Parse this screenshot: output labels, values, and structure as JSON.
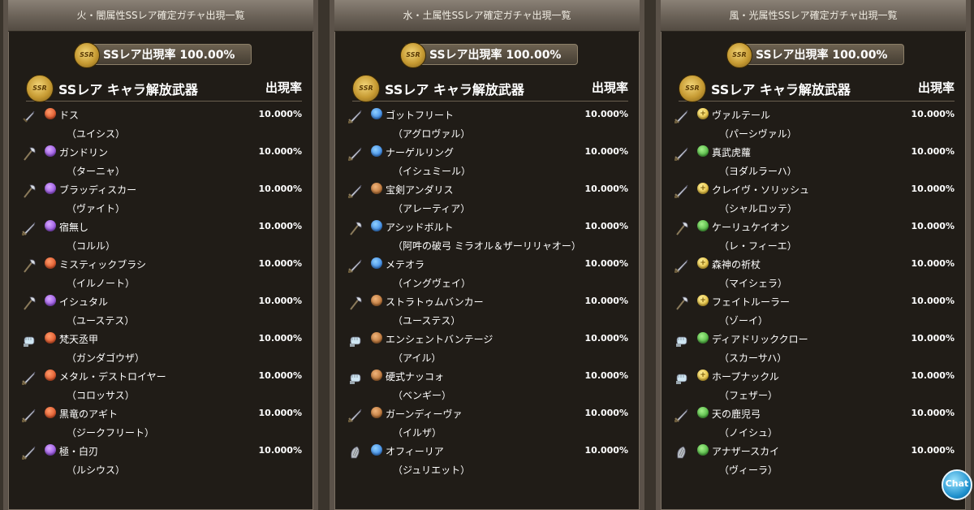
{
  "rate_banner": "SSレア出現率 100.00%",
  "ssr_badge": "SSR",
  "list_title": "SSレア キャラ解放武器",
  "rate_column": "出現率",
  "chat_label": "Chat",
  "panels": [
    {
      "title": "火・闇属性SSレア確定ガチャ出現一覧",
      "items": [
        {
          "weapon_icon": "dagger-icon",
          "element": "fire",
          "name": "ドス",
          "character": "（ユイシス）",
          "rate": "10.000%"
        },
        {
          "weapon_icon": "axe-icon",
          "element": "dark",
          "name": "ガンドリン",
          "character": "（ターニャ）",
          "rate": "10.000%"
        },
        {
          "weapon_icon": "axe-icon",
          "element": "dark",
          "name": "ブラッディスカー",
          "character": "（ヴァイト）",
          "rate": "10.000%"
        },
        {
          "weapon_icon": "sword-icon",
          "element": "dark",
          "name": "宿無し",
          "character": "（コルル）",
          "rate": "10.000%"
        },
        {
          "weapon_icon": "axe-icon",
          "element": "fire",
          "name": "ミスティックブラシ",
          "character": "（イルノート）",
          "rate": "10.000%"
        },
        {
          "weapon_icon": "axe-icon",
          "element": "dark",
          "name": "イシュタル",
          "character": "（ユーステス）",
          "rate": "10.000%"
        },
        {
          "weapon_icon": "fist-icon",
          "element": "fire",
          "name": "梵天丞甲",
          "character": "（ガンダゴウザ）",
          "rate": "10.000%"
        },
        {
          "weapon_icon": "sword-icon",
          "element": "fire",
          "name": "メタル・デストロイヤー",
          "character": "（コロッサス）",
          "rate": "10.000%"
        },
        {
          "weapon_icon": "sword-icon",
          "element": "fire",
          "name": "黒竜のアギト",
          "character": "（ジークフリート）",
          "rate": "10.000%"
        },
        {
          "weapon_icon": "sword-icon",
          "element": "dark",
          "name": "極・白刃",
          "character": "（ルシウス）",
          "rate": "10.000%"
        }
      ]
    },
    {
      "title": "水・土属性SSレア確定ガチャ出現一覧",
      "items": [
        {
          "weapon_icon": "sword-icon",
          "element": "water",
          "name": "ゴットフリート",
          "character": "（アグロヴァル）",
          "rate": "10.000%"
        },
        {
          "weapon_icon": "sword-icon",
          "element": "water",
          "name": "ナーゲルリング",
          "character": "（イシュミール）",
          "rate": "10.000%"
        },
        {
          "weapon_icon": "sword-icon",
          "element": "earth",
          "name": "宝剣アンダリス",
          "character": "（アレーティア）",
          "rate": "10.000%"
        },
        {
          "weapon_icon": "axe-icon",
          "element": "water",
          "name": "アシッドボルト",
          "character": "（阿吽の破弓 ミラオル＆ザーリリャオー）",
          "rate": "10.000%"
        },
        {
          "weapon_icon": "sword-icon",
          "element": "water",
          "name": "メテオラ",
          "character": "（イングヴェイ）",
          "rate": "10.000%"
        },
        {
          "weapon_icon": "axe-icon",
          "element": "earth",
          "name": "ストラトゥムバンカー",
          "character": "（ユーステス）",
          "rate": "10.000%"
        },
        {
          "weapon_icon": "fist-icon",
          "element": "earth",
          "name": "エンシェントバンテージ",
          "character": "（アイル）",
          "rate": "10.000%"
        },
        {
          "weapon_icon": "fist-icon",
          "element": "earth",
          "name": "硬式ナッコォ",
          "character": "（ベンギー）",
          "rate": "10.000%"
        },
        {
          "weapon_icon": "sword-icon",
          "element": "earth",
          "name": "ガーンディーヴァ",
          "character": "（イルザ）",
          "rate": "10.000%"
        },
        {
          "weapon_icon": "harp-icon",
          "element": "water",
          "name": "オフィーリア",
          "character": "（ジュリエット）",
          "rate": "10.000%"
        }
      ]
    },
    {
      "title": "風・光属性SSレア確定ガチャ出現一覧",
      "items": [
        {
          "weapon_icon": "sword-icon",
          "element": "light",
          "name": "ヴァルテール",
          "character": "（パーシヴァル）",
          "rate": "10.000%"
        },
        {
          "weapon_icon": "sword-icon",
          "element": "wind",
          "name": "真武虎蘿",
          "character": "（ヨダルラーハ）",
          "rate": "10.000%"
        },
        {
          "weapon_icon": "sword-icon",
          "element": "light",
          "name": "クレイヴ・ソリッシュ",
          "character": "（シャルロッテ）",
          "rate": "10.000%"
        },
        {
          "weapon_icon": "axe-icon",
          "element": "wind",
          "name": "ケーリュケイオン",
          "character": "（レ・フィーエ）",
          "rate": "10.000%"
        },
        {
          "weapon_icon": "sword-icon",
          "element": "light",
          "name": "森神の祈杖",
          "character": "（マイシェラ）",
          "rate": "10.000%"
        },
        {
          "weapon_icon": "axe-icon",
          "element": "light",
          "name": "フェイトルーラー",
          "character": "（ゾーイ）",
          "rate": "10.000%"
        },
        {
          "weapon_icon": "fist-icon",
          "element": "wind",
          "name": "ディアドリッククロー",
          "character": "（スカーサハ）",
          "rate": "10.000%"
        },
        {
          "weapon_icon": "fist-icon",
          "element": "light",
          "name": "ホープナックル",
          "character": "（フェザー）",
          "rate": "10.000%"
        },
        {
          "weapon_icon": "sword-icon",
          "element": "wind",
          "name": "天の鹿児弓",
          "character": "（ノイシュ）",
          "rate": "10.000%"
        },
        {
          "weapon_icon": "harp-icon",
          "element": "wind",
          "name": "アナザースカイ",
          "character": "（ヴィーラ）",
          "rate": "10.000%"
        }
      ]
    }
  ]
}
